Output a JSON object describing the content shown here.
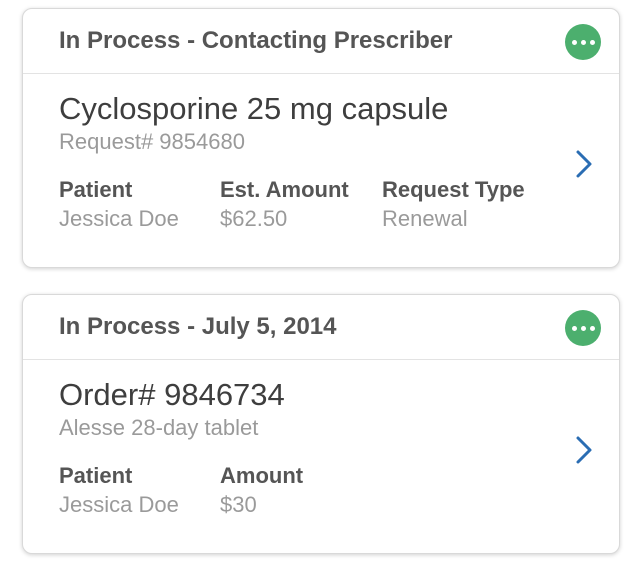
{
  "cards": [
    {
      "status": "In Process - Contacting Prescriber",
      "title": "Cyclosporine 25 mg capsule",
      "subtitle": "Request# 9854680",
      "fields": [
        {
          "label": "Patient",
          "value": "Jessica Doe"
        },
        {
          "label": "Est. Amount",
          "value": "$62.50"
        },
        {
          "label": "Request Type",
          "value": "Renewal"
        }
      ]
    },
    {
      "status": "In Process - July 5, 2014",
      "title": "Order# 9846734",
      "subtitle": "Alesse 28-day tablet",
      "fields": [
        {
          "label": "Patient",
          "value": "Jessica Doe"
        },
        {
          "label": "Amount",
          "value": "$30"
        }
      ]
    }
  ],
  "icons": {
    "more": "more-dots-icon",
    "chevron": "chevron-right-icon"
  },
  "colors": {
    "accent_green": "#4caf6e",
    "chevron_blue": "#2a6db3",
    "label_text": "#555555",
    "secondary_text": "#9a9a9a"
  }
}
